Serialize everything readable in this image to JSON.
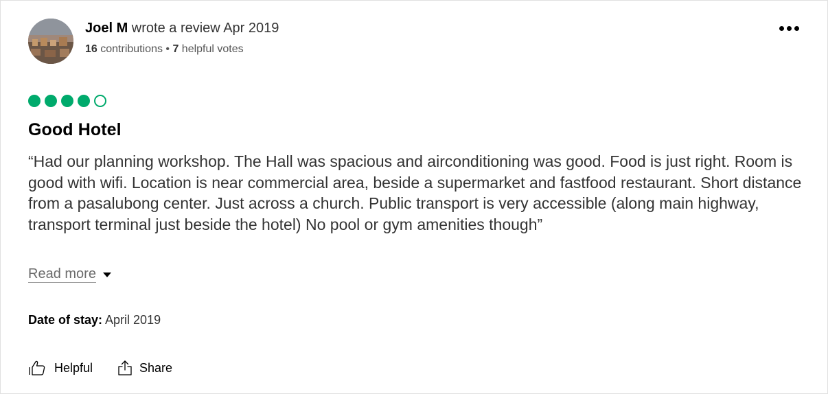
{
  "review": {
    "author": {
      "name": "Joel M",
      "action_text": " wrote a review Apr 2019",
      "contributions_count": "16",
      "contributions_label": " contributions • ",
      "helpful_votes_count": "7",
      "helpful_votes_label": " helpful votes"
    },
    "rating": {
      "value": 4,
      "max": 5,
      "color": "#00aa6c"
    },
    "title": "Good Hotel",
    "body": "“Had our planning workshop. The Hall was spacious and airconditioning was good. Food is just right. Room is good with wifi. Location is near commercial area, beside a supermarket and fastfood restaurant. Short distance from a pasalubong center. Just across a church. Public transport is very accessible (along main highway, transport terminal just beside the hotel) No pool or gym amenities though”",
    "read_more_label": "Read more",
    "date_of_stay_label": "Date of stay:",
    "date_of_stay_value": " April 2019",
    "actions": {
      "helpful_label": "Helpful",
      "share_label": "Share"
    }
  },
  "icons": {
    "more": "more-options-icon",
    "helpful": "thumbs-up-icon",
    "share": "share-icon",
    "read_more": "caret-down-icon"
  }
}
